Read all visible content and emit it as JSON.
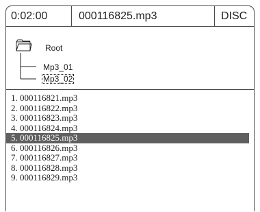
{
  "status_bar": {
    "time": "0:02:00",
    "current_file": "000116825.mp3",
    "source": "DISC"
  },
  "folder_tree": {
    "root_label": "Root",
    "items": [
      {
        "label": "Mp3_01"
      },
      {
        "label": "Mp3_02",
        "focused": true
      }
    ]
  },
  "file_list": {
    "selected_index": 4,
    "items": [
      {
        "label": "1. 000116821.mp3"
      },
      {
        "label": "2. 000116822.mp3"
      },
      {
        "label": "3. 000116823.mp3"
      },
      {
        "label": "4. 000116824.mp3"
      },
      {
        "label": "5. 000116825.mp3"
      },
      {
        "label": "6. 000116826.mp3"
      },
      {
        "label": "7. 000116827.mp3"
      },
      {
        "label": "8. 000116828.mp3"
      },
      {
        "label": "9. 000116829.mp3"
      }
    ]
  },
  "colors": {
    "selection": "#5f5f5f",
    "border": "#4a4a4a"
  },
  "icons": {
    "root": "folder-icon"
  }
}
